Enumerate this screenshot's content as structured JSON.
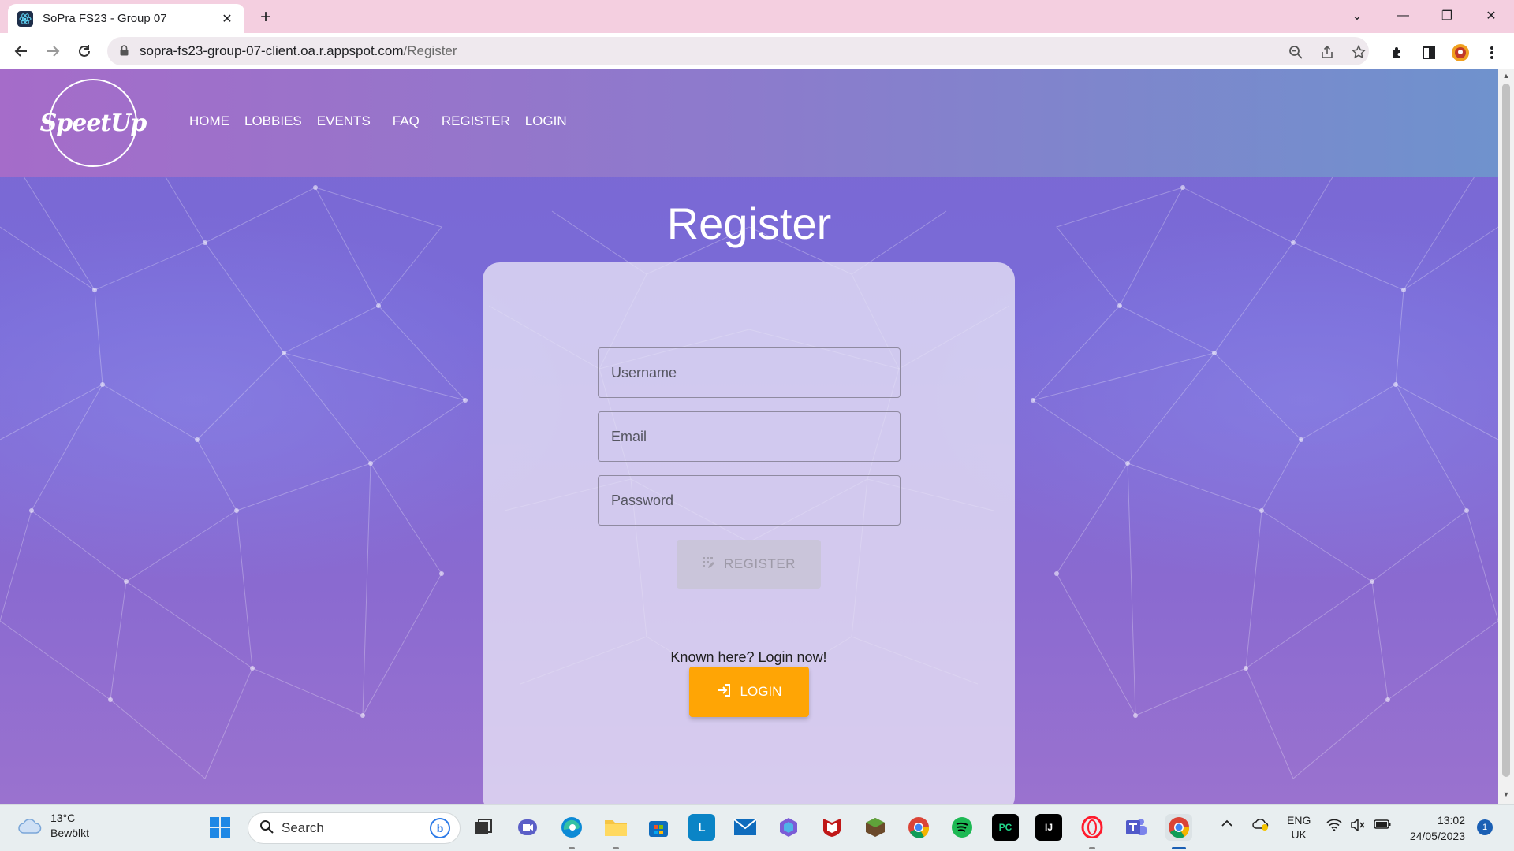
{
  "browser": {
    "tab_title": "SoPra FS23 - Group 07",
    "tab_close": "✕",
    "new_tab": "+",
    "url_host": "sopra-fs23-group-07-client.oa.r.appspot.com",
    "url_path": "/Register",
    "window_controls": {
      "dropdown": "⌄",
      "minimize": "—",
      "restore": "❐",
      "close": "✕"
    }
  },
  "site": {
    "logo_text": "SpeetUp",
    "nav": [
      "HOME",
      "LOBBIES",
      "EVENTS",
      "FAQ",
      "REGISTER",
      "LOGIN"
    ]
  },
  "register": {
    "title": "Register",
    "username_placeholder": "Username",
    "email_placeholder": "Email",
    "password_placeholder": "Password",
    "register_button": "REGISTER",
    "register_enabled": false,
    "login_prompt": "Known here? Login now!",
    "login_button": "LOGIN"
  },
  "taskbar": {
    "weather_temp": "13°C",
    "weather_desc": "Bewölkt",
    "search_label": "Search",
    "bing_label": "b",
    "apps": [
      "windows-start",
      "task-view",
      "teams-meet",
      "edge",
      "file-explorer",
      "microsoft-store",
      "l-app",
      "mail",
      "copilot",
      "mcafee",
      "minecraft",
      "chrome",
      "spotify",
      "pycharm",
      "intellij",
      "opera",
      "teams",
      "chrome-active"
    ],
    "language_line1": "ENG",
    "language_line2": "UK",
    "time": "13:02",
    "date": "24/05/2023",
    "notification_count": "1"
  },
  "colors": {
    "nav_gradient_start": "#a56cc9",
    "nav_gradient_end": "#6f92cd",
    "background": "#7b67d2",
    "login_button": "#ffa505",
    "register_button_disabled": "#c8c4d6"
  }
}
